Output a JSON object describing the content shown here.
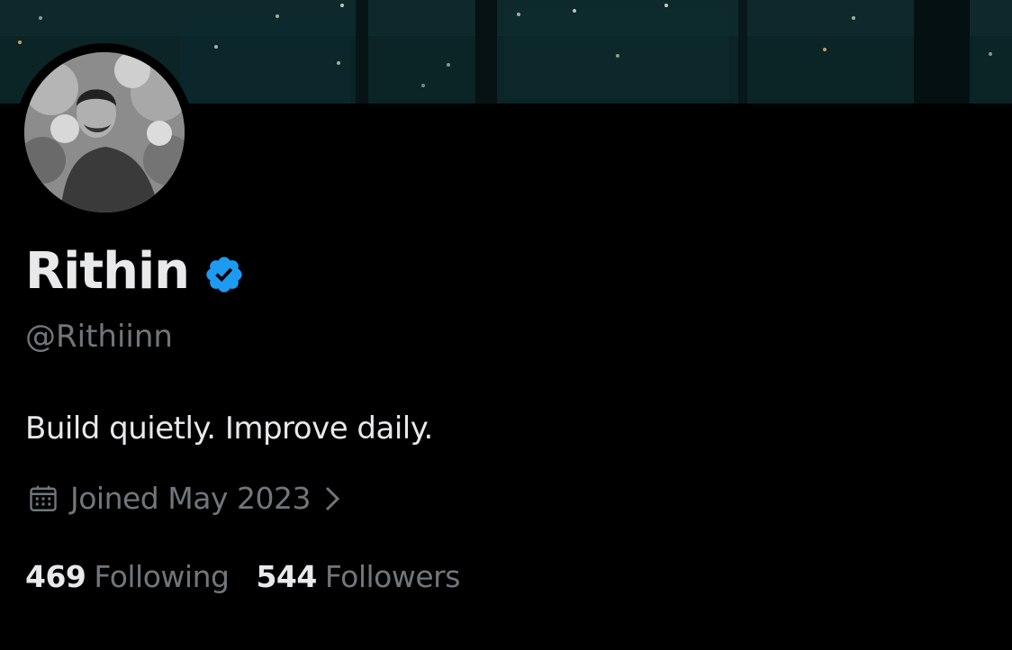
{
  "profile": {
    "name": "Rithin",
    "handle": "@Rithiinn",
    "bio": "Build quietly. Improve daily.",
    "joined": "Joined May 2023",
    "verified": true
  },
  "stats": {
    "following_count": "469",
    "following_label": "Following",
    "followers_count": "544",
    "followers_label": "Followers"
  },
  "icons": {
    "verified": "verified-badge-icon",
    "calendar": "calendar-icon",
    "chevron": "chevron-right-icon"
  },
  "colors": {
    "background": "#000000",
    "primary_text": "#e7e9ea",
    "secondary_text": "#71767b",
    "verified_blue": "#1d9bf0"
  }
}
